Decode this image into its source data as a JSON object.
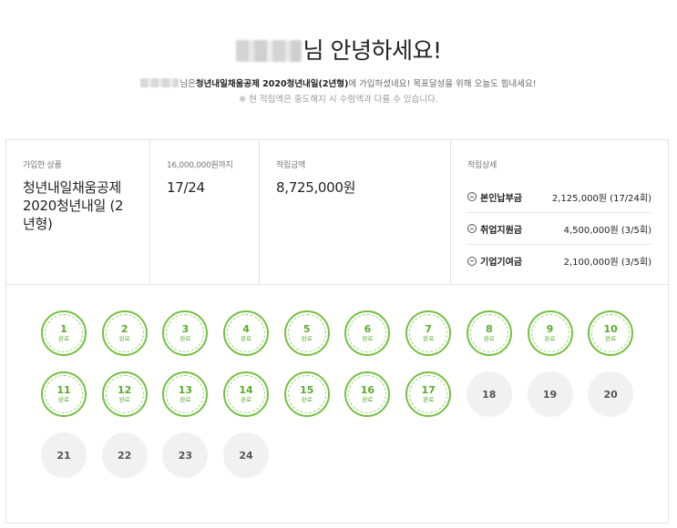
{
  "greeting": {
    "title_suffix": "님 안녕하세요!",
    "sub_prefix": "님은 ",
    "product_bold": "청년내일채움공제 2020청년내일(2년형)",
    "sub_suffix": "에 가입하셨네요! 목표달성을 위해 오늘도 힘내세요!",
    "notice": "※ 현 적립액은 중도해지 시 수령액과 다를 수 있습니다."
  },
  "summary": {
    "product": {
      "label": "가입한 상품",
      "value": "청년내일채움공제 2020청년내일 (2년형)"
    },
    "count": {
      "label": "16,000,000원까지",
      "value": "17/24"
    },
    "amount": {
      "label": "적립금액",
      "value": "8,725,000원"
    },
    "detail": {
      "label": "적립상세",
      "rows": [
        {
          "name": "본인납부금",
          "value": "2,125,000원 (17/24회)",
          "icon": "circle-minus-icon"
        },
        {
          "name": "취업지원금",
          "value": "4,500,000원 (3/5회)",
          "icon": "circle-minus-icon"
        },
        {
          "name": "기업기여금",
          "value": "2,100,000원 (3/5회)",
          "icon": "circle-minus-icon"
        }
      ]
    }
  },
  "stamps": {
    "done_label": "완료",
    "completed": 17,
    "total": 24,
    "items": [
      "1",
      "2",
      "3",
      "4",
      "5",
      "6",
      "7",
      "8",
      "9",
      "10",
      "11",
      "12",
      "13",
      "14",
      "15",
      "16",
      "17",
      "18",
      "19",
      "20",
      "21",
      "22",
      "23",
      "24"
    ]
  },
  "colors": {
    "accent_green": "#75c043",
    "pending_gray": "#f1f1f1",
    "border": "#e3e3e3"
  }
}
